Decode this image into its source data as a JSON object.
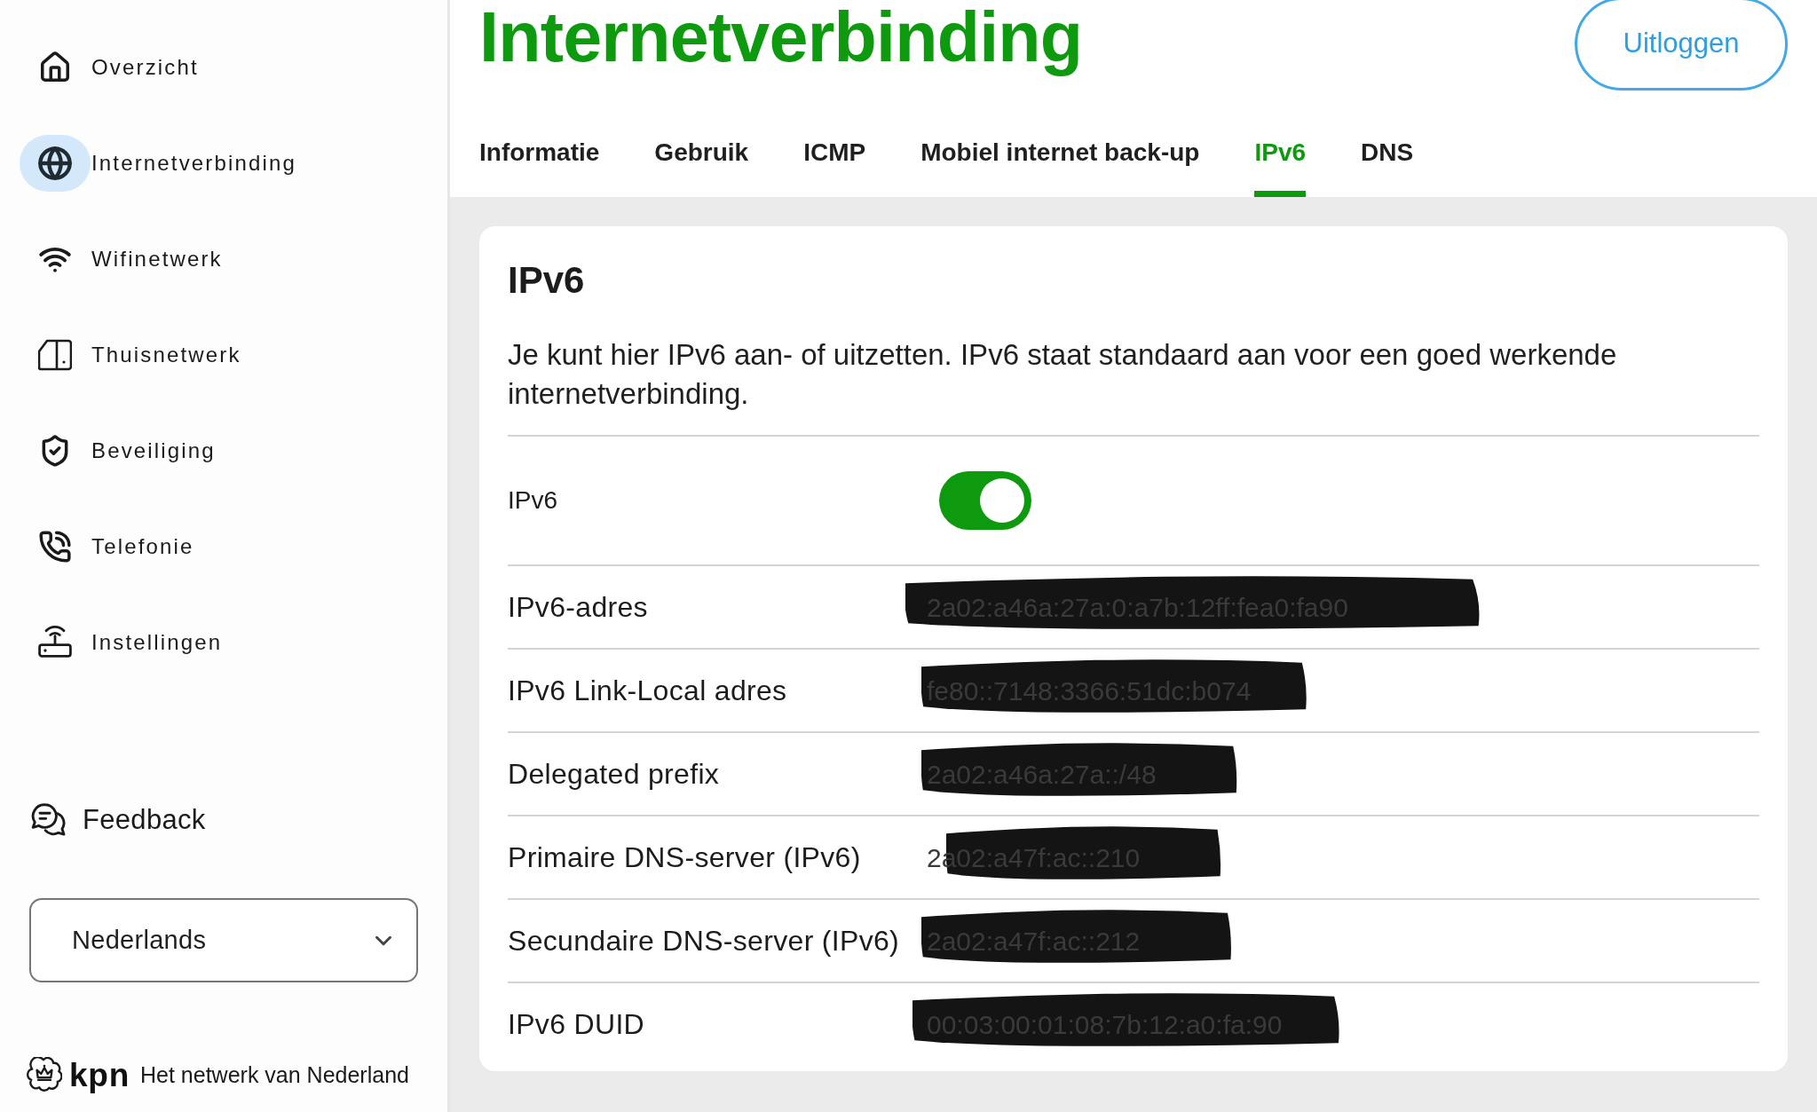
{
  "sidebar": {
    "items": [
      {
        "label": "Overzicht",
        "selected": false
      },
      {
        "label": "Internetverbinding",
        "selected": true
      },
      {
        "label": "Wifinetwerk",
        "selected": false
      },
      {
        "label": "Thuisnetwerk",
        "selected": false
      },
      {
        "label": "Beveiliging",
        "selected": false
      },
      {
        "label": "Telefonie",
        "selected": false
      },
      {
        "label": "Instellingen",
        "selected": false
      }
    ],
    "feedback": {
      "label": "Feedback"
    },
    "language_select": {
      "value": "Nederlands"
    },
    "brand": {
      "logo_text": "kpn",
      "tagline": "Het netwerk van Nederland"
    }
  },
  "header": {
    "title": "Internetverbinding",
    "logout_button": "Uitloggen"
  },
  "tabs": [
    {
      "label": "Informatie",
      "selected": false
    },
    {
      "label": "Gebruik",
      "selected": false
    },
    {
      "label": "ICMP",
      "selected": false
    },
    {
      "label": "Mobiel internet back-up",
      "selected": false
    },
    {
      "label": "IPv6",
      "selected": true
    },
    {
      "label": "DNS",
      "selected": false
    }
  ],
  "card": {
    "title": "IPv6",
    "description": "Je kunt hier IPv6 aan- of uitzetten. IPv6 staat standaard aan voor een goed werkende internetverbinding.",
    "toggle": {
      "label": "IPv6",
      "on": true
    },
    "rows": [
      {
        "label": "IPv6-adres",
        "value": "2a02:a46a:27a:0:a7b:12ff:fea0:fa90",
        "redacted": true
      },
      {
        "label": "IPv6 Link-Local adres",
        "value": "fe80::7148:3366:51dc:b074",
        "redacted": true
      },
      {
        "label": "Delegated prefix",
        "value": "2a02:a46a:27a::/48",
        "redacted": true
      },
      {
        "label": "Primaire DNS-server (IPv6)",
        "value": "2a02:a47f:ac::210",
        "redacted": true
      },
      {
        "label": "Secundaire DNS-server (IPv6)",
        "value": "2a02:a47f:ac::212",
        "redacted": true
      },
      {
        "label": "IPv6 DUID",
        "value": "00:03:00:01:08:7b:12:a0:fa:90",
        "redacted": true
      }
    ]
  }
}
